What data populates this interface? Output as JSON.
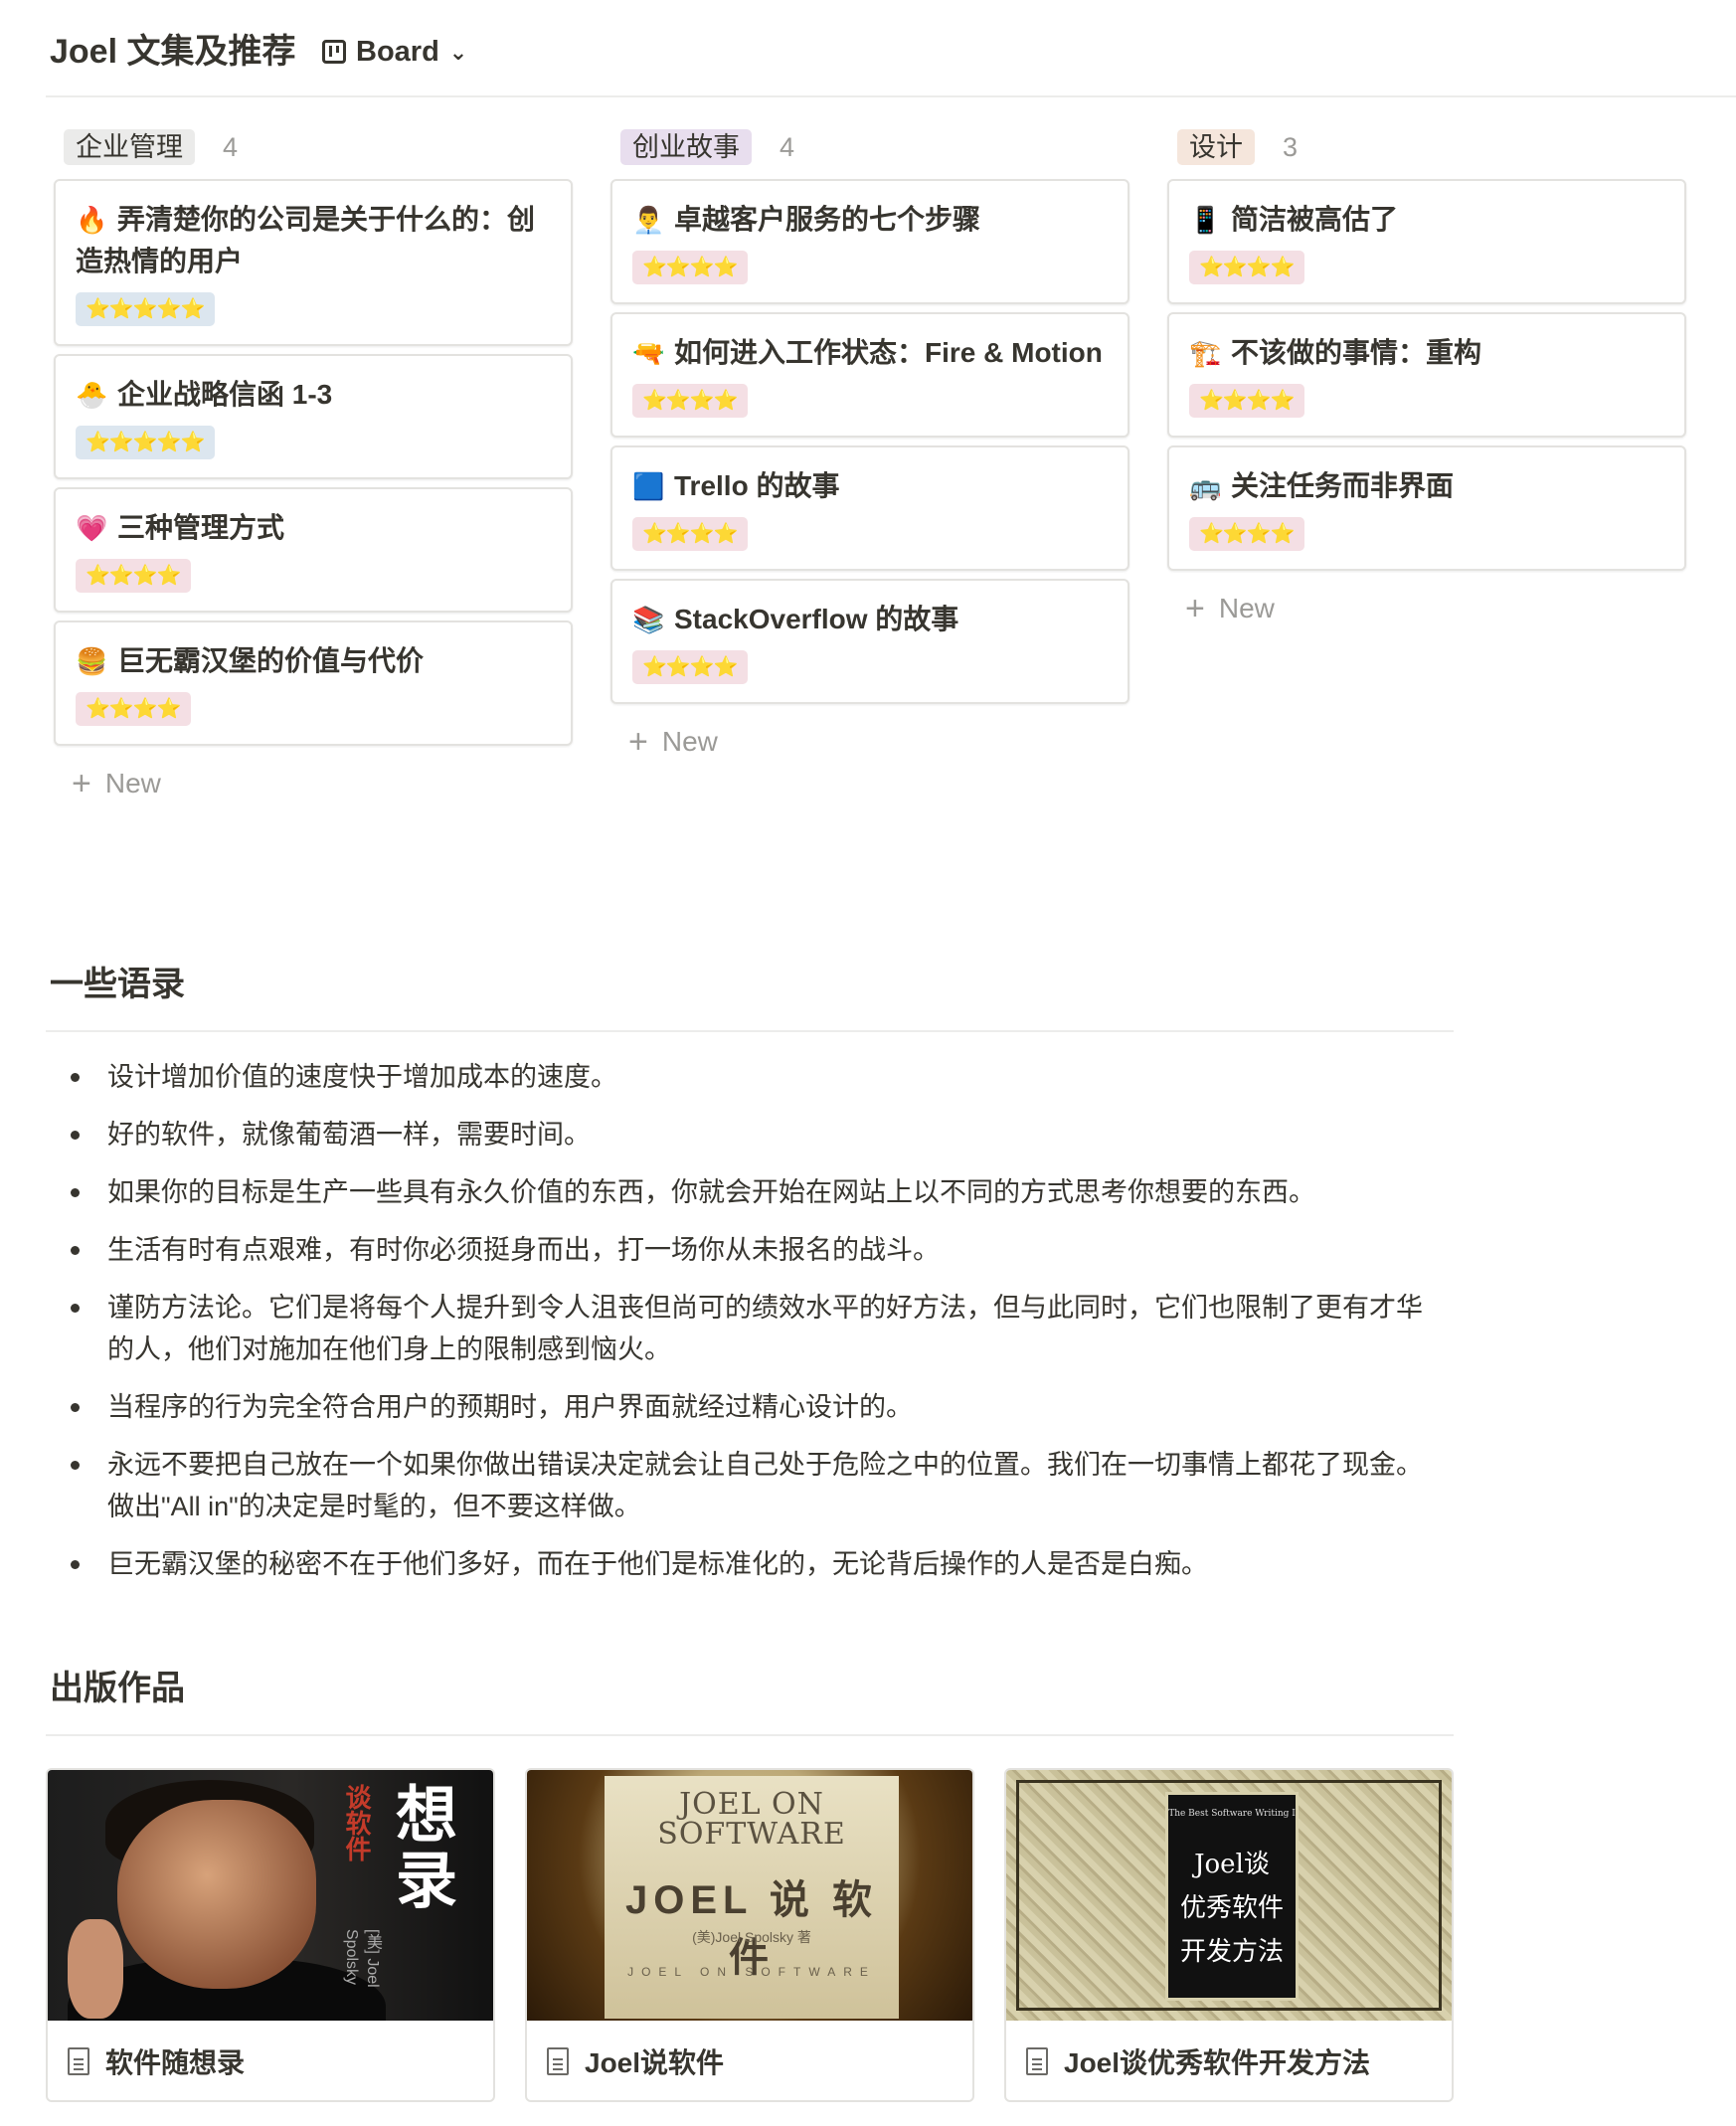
{
  "header": {
    "title": "Joel 文集及推荐",
    "view": {
      "label": "Board",
      "icon": "board-icon"
    }
  },
  "board": {
    "columns": [
      {
        "name": "企业管理",
        "count": "4",
        "color": "#ebebea",
        "cards": [
          {
            "emoji": "🔥",
            "title": "弄清楚你的公司是关于什么的：创造热情的用户",
            "rating": "⭐⭐⭐⭐⭐",
            "rating_bg": "#dce6ef"
          },
          {
            "emoji": "🐣",
            "title": "企业战略信函 1-3",
            "rating": "⭐⭐⭐⭐⭐",
            "rating_bg": "#dce6ef"
          },
          {
            "emoji": "💗",
            "title": "三种管理方式",
            "rating": "⭐⭐⭐⭐",
            "rating_bg": "#f4dfe4"
          },
          {
            "emoji": "🍔",
            "title": "巨无霸汉堡的价值与代价",
            "rating": "⭐⭐⭐⭐",
            "rating_bg": "#f4dfe4"
          }
        ],
        "new_label": "New"
      },
      {
        "name": "创业故事",
        "count": "4",
        "color": "#e8deee",
        "cards": [
          {
            "emoji": "👨‍💼",
            "title": "卓越客户服务的七个步骤",
            "rating": "⭐⭐⭐⭐",
            "rating_bg": "#f4dfe4"
          },
          {
            "emoji": "🔫",
            "title": "如何进入工作状态：Fire & Motion",
            "rating": "⭐⭐⭐⭐",
            "rating_bg": "#f4dfe4"
          },
          {
            "emoji": "🟦",
            "title": "Trello 的故事",
            "rating": "⭐⭐⭐⭐",
            "rating_bg": "#f4dfe4"
          },
          {
            "emoji": "📚",
            "title": "StackOverflow 的故事",
            "rating": "⭐⭐⭐⭐",
            "rating_bg": "#f4dfe4"
          }
        ],
        "new_label": "New"
      },
      {
        "name": "设计",
        "count": "3",
        "color": "#f5e6dc",
        "cards": [
          {
            "emoji": "📱",
            "title": "简洁被高估了",
            "rating": "⭐⭐⭐⭐",
            "rating_bg": "#f4dfe4"
          },
          {
            "emoji": "🏗️",
            "title": "不该做的事情：重构",
            "rating": "⭐⭐⭐⭐",
            "rating_bg": "#f4dfe4"
          },
          {
            "emoji": "🚌",
            "title": "关注任务而非界面",
            "rating": "⭐⭐⭐⭐",
            "rating_bg": "#f4dfe4"
          }
        ],
        "new_label": "New"
      }
    ]
  },
  "quotes_section": {
    "heading": "一些语录",
    "items": [
      "设计增加价值的速度快于增加成本的速度。",
      "好的软件，就像葡萄酒一样，需要时间。",
      "如果你的目标是生产一些具有永久价值的东西，你就会开始在网站上以不同的方式思考你想要的东西。",
      "生活有时有点艰难，有时你必须挺身而出，打一场你从未报名的战斗。",
      "谨防方法论。它们是将每个人提升到令人沮丧但尚可的绩效水平的好方法，但与此同时，它们也限制了更有才华的人，他们对施加在他们身上的限制感到恼火。",
      "当程序的行为完全符合用户的预期时，用户界面就经过精心设计的。",
      "永远不要把自己放在一个如果你做出错误决定就会让自己处于危险之中的位置。我们在一切事情上都花了现金。做出\"All in\"的决定是时髦的，但不要这样做。",
      "巨无霸汉堡的秘密不在于他们多好，而在于他们是标准化的，无论背后操作的人是否是白痴。"
    ]
  },
  "publications": {
    "heading": "出版作品",
    "items": [
      {
        "title": "软件随想录",
        "icon": "document-icon",
        "cover": {
          "vertical_title": "想录",
          "vertical_sub": "谈软件",
          "author": "[美] Joel Spolsky"
        }
      },
      {
        "title": "Joel说软件",
        "icon": "document-icon",
        "cover": {
          "title_en": "JOEL ON SOFTWARE",
          "title_cn": "JOEL 说 软 件",
          "sub": "(美)Joel Spolsky 著",
          "sub2": "JOEL ON SOFTWARE"
        }
      },
      {
        "title": "Joel谈优秀软件开发方法",
        "icon": "document-icon",
        "cover": {
          "series": "The Best Software Writing I",
          "line1": "Joel谈",
          "line2": "优秀软件",
          "line3": "开发方法"
        }
      }
    ]
  }
}
